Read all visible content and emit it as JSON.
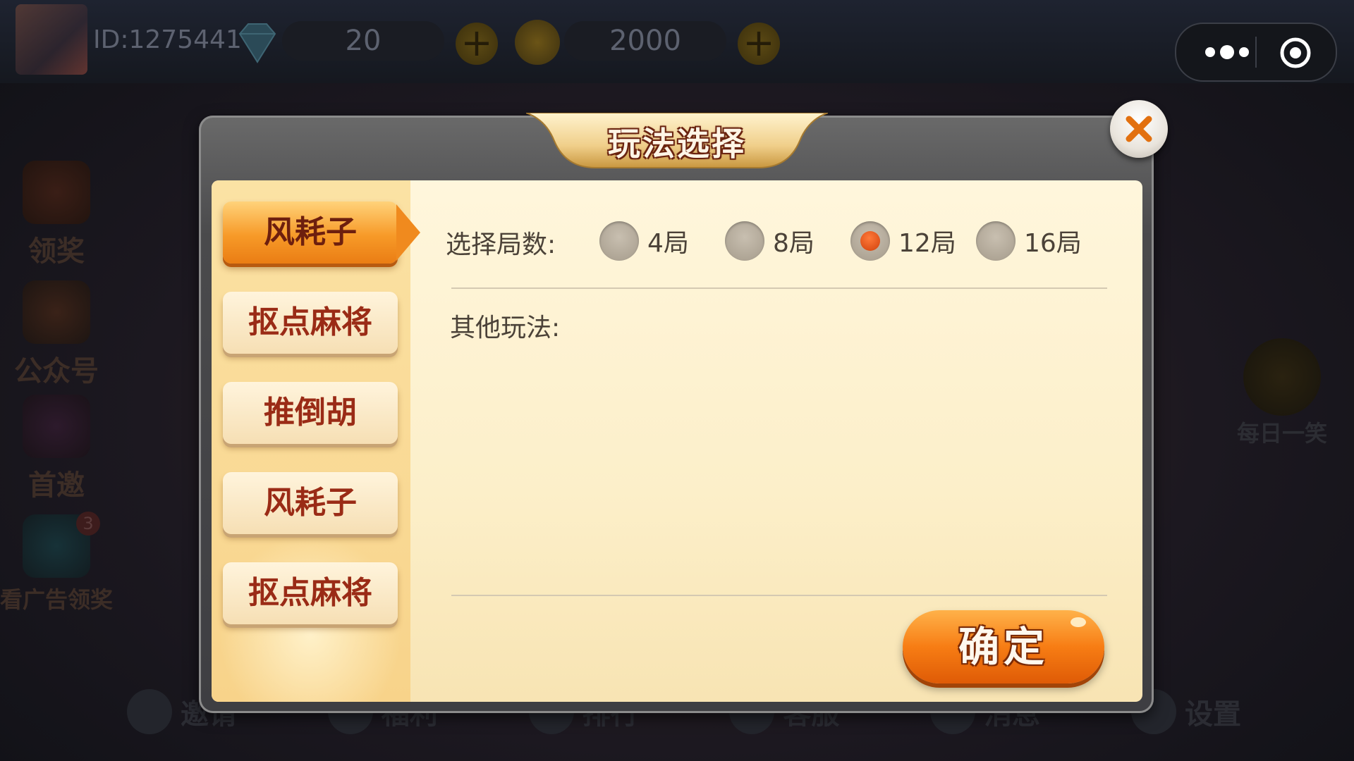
{
  "player": {
    "id_text": "ID:1275441",
    "diamonds": "20",
    "coins": "2000"
  },
  "lobby": {
    "side_items": [
      {
        "label": "领奖"
      },
      {
        "label": "公众号"
      },
      {
        "label": "首邀"
      },
      {
        "label": "看广告领奖",
        "badge": "3"
      }
    ],
    "right_item": {
      "label": "每日一笑"
    },
    "bottom_nav": [
      {
        "label": "邀请"
      },
      {
        "label": "福利"
      },
      {
        "label": "排行"
      },
      {
        "label": "客服"
      },
      {
        "label": "消息"
      },
      {
        "label": "设置"
      }
    ]
  },
  "dialog": {
    "title": "玩法选择",
    "modes": [
      {
        "label": "风耗子",
        "active": true
      },
      {
        "label": "抠点麻将",
        "active": false
      },
      {
        "label": "推倒胡",
        "active": false
      },
      {
        "label": "风耗子",
        "active": false
      },
      {
        "label": "抠点麻将",
        "active": false
      }
    ],
    "rounds_label": "选择局数:",
    "round_options": [
      {
        "label": "4局",
        "selected": false
      },
      {
        "label": "8局",
        "selected": false
      },
      {
        "label": "12局",
        "selected": true
      },
      {
        "label": "16局",
        "selected": false
      }
    ],
    "other_label": "其他玩法:",
    "confirm_label": "确定"
  },
  "colors": {
    "accent_orange": "#f08a1e",
    "title_gold": "#e8c580",
    "panel_cream": "#fcefc9",
    "tab_text": "#9a2b16"
  }
}
